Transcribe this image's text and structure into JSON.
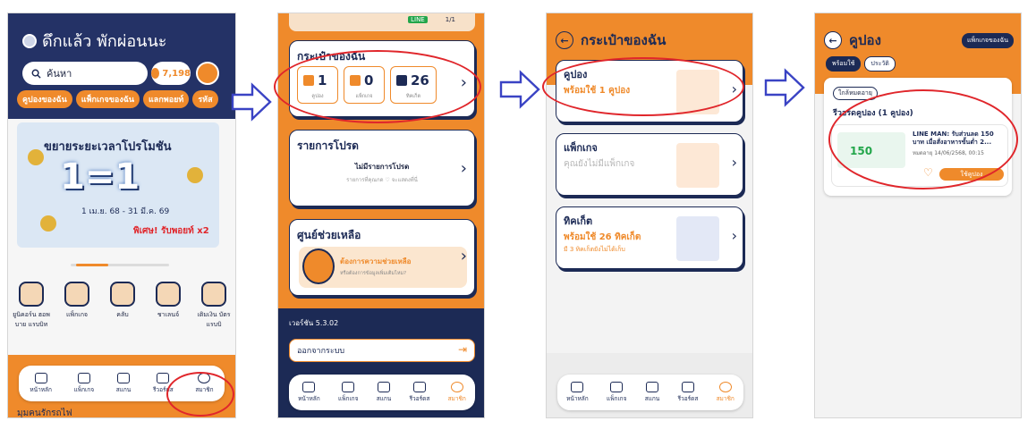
{
  "screen1": {
    "greeting": "ดึกแล้ว พักผ่อนนะ",
    "search_placeholder": "ค้นหา",
    "points": "7,198",
    "chips": [
      "คูปองของฉัน",
      "แพ็กเกจของฉัน",
      "แลกพอยท์",
      "รหัส"
    ],
    "banner": {
      "headline": "ขยายระยะเวลาโปรโมชัน",
      "big": "1=1",
      "dates": "1 เม.ย. 68 - 31 มี.ค. 69",
      "special": "พิเศษ! รับพอยท์ x2"
    },
    "quick_items": [
      "ยูนิคอร์น ฮอพ บาย แรบบิท",
      "แพ็กเกจ",
      "คลับ",
      "ชาเลนจ์",
      "เติมเงิน บัตรแรบบิ"
    ],
    "nav": [
      "หน้าหลัก",
      "แพ็กเกจ",
      "สแกน",
      "รีวอร์ดส",
      "สมาชิก"
    ],
    "bottom_text": "มุมคนรักรถไฟ"
  },
  "screen2": {
    "top_card": {
      "brand": "LINE",
      "count": "1/1"
    },
    "wallet": {
      "title": "กระเป๋าของฉัน",
      "tiles": [
        {
          "value": "1",
          "label": "คูปอง"
        },
        {
          "value": "0",
          "label": "แพ็กเกจ"
        },
        {
          "value": "26",
          "label": "ทิคเก็ต"
        }
      ]
    },
    "favorites": {
      "title": "รายการโปรด",
      "empty": "ไม่มีรายการโปรด",
      "hint": "รายการที่คุณกด ♡ จะแสดงที่นี่"
    },
    "help": {
      "title": "ศูนย์ช่วยเหลือ",
      "cta": "ต้องการความช่วยเหลือ",
      "sub": "หรือต้องการข้อมูลเพิ่มเติมไหม?"
    },
    "version": "เวอร์ชัน 5.3.02",
    "logout": "ออกจากระบบ",
    "nav": [
      "หน้าหลัก",
      "แพ็กเกจ",
      "สแกน",
      "รีวอร์ดส",
      "สมาชิก"
    ]
  },
  "screen3": {
    "title": "กระเป๋าของฉัน",
    "cards": [
      {
        "title": "คูปอง",
        "status": "พร้อมใช้ 1 คูปอง",
        "note": ""
      },
      {
        "title": "แพ็กเกจ",
        "status": "คุณยังไม่มีแพ็กเกจ",
        "note": ""
      },
      {
        "title": "ทิคเก็ต",
        "status": "พร้อมใช้ 26 ทิคเก็ต",
        "note": "มี 3 ทิคเก็ตยังไม่ได้เก็บ"
      }
    ],
    "nav": [
      "หน้าหลัก",
      "แพ็กเกจ",
      "สแกน",
      "รีวอร์ดส",
      "สมาชิก"
    ]
  },
  "screen4": {
    "title": "คูปอง",
    "pkg_button": "แพ็กเกจของฉัน",
    "tabs": [
      "พร้อมใช้",
      "ประวัติ"
    ],
    "near_expiry": "ใกล้หมดอายุ",
    "section_title": "รีวอร์ดคูปอง (1 คูปอง)",
    "coupon": {
      "thumb_value": "150",
      "name": "LINE MAN: รับส่วนลด 150 บาท เมื่อสั่งอาหารขั้นต่ำ 2...",
      "expiry": "หมดอายุ 14/06/2568, 00:15",
      "use_label": "ใช้คูปอง"
    }
  },
  "colors": {
    "navy": "#1c2a55",
    "orange": "#ef8a2b",
    "highlight": "#e0262b",
    "arrow": "#3a43c4"
  }
}
